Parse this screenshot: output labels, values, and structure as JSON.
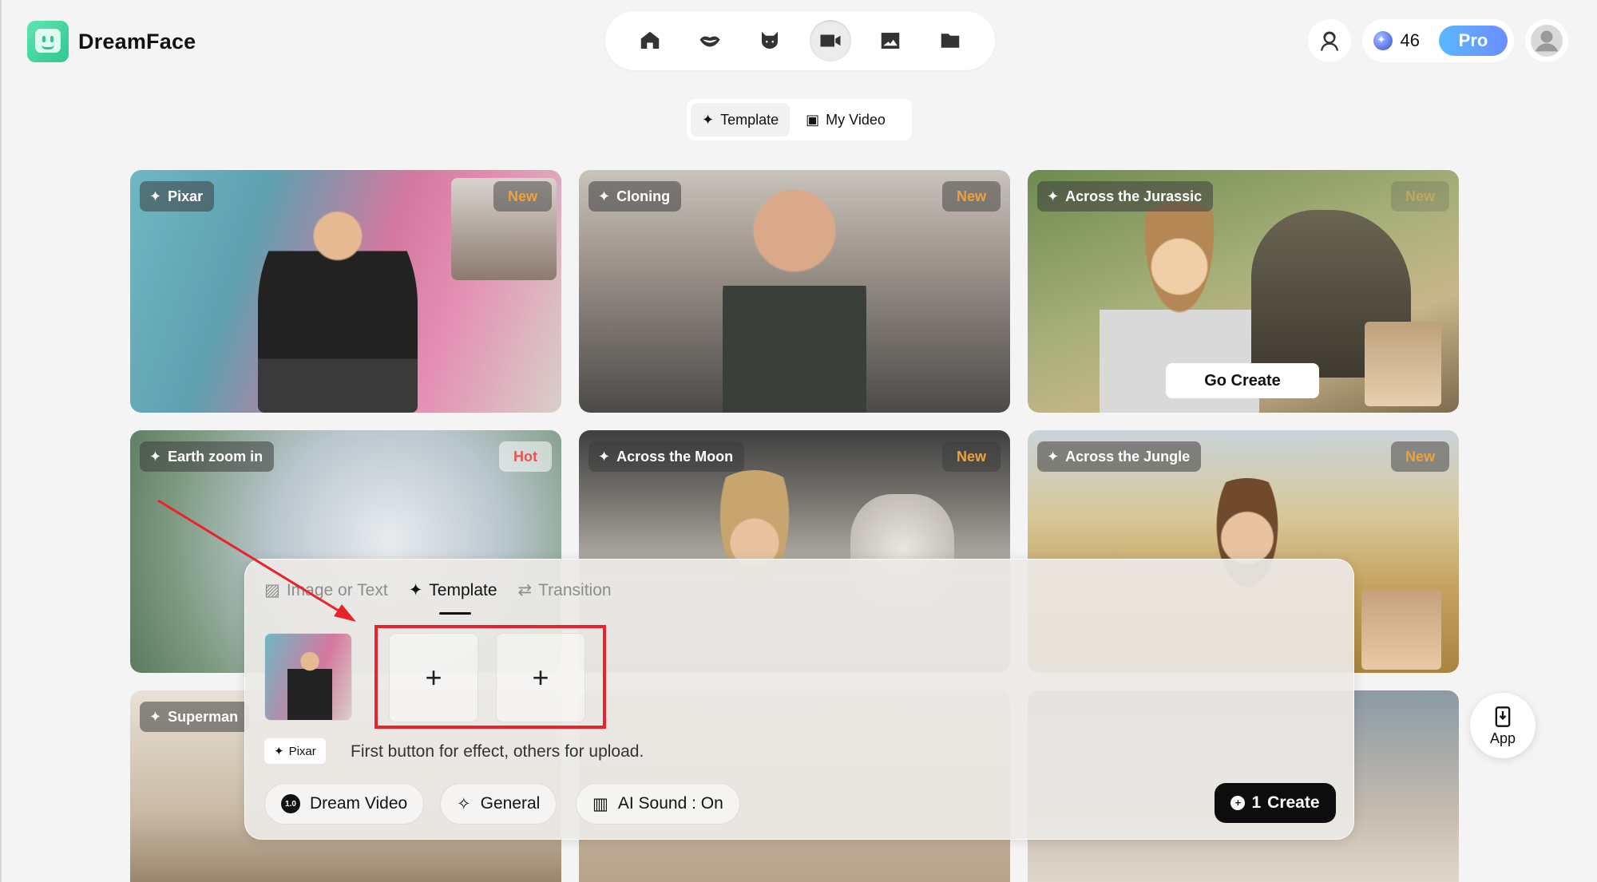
{
  "app": {
    "name": "DreamFace"
  },
  "nav": {
    "items": [
      {
        "icon": "home-icon"
      },
      {
        "icon": "lips-icon"
      },
      {
        "icon": "cat-icon"
      },
      {
        "icon": "video-camera-icon",
        "active": true
      },
      {
        "icon": "image-icon"
      },
      {
        "icon": "folder-icon"
      }
    ]
  },
  "header": {
    "credits": "46",
    "pro_label": "Pro"
  },
  "segment": {
    "template_label": "Template",
    "myvideo_label": "My Video"
  },
  "cards": [
    {
      "title": "Pixar",
      "badge": "New"
    },
    {
      "title": "Cloning",
      "badge": "New"
    },
    {
      "title": "Across the Jurassic",
      "badge": "New",
      "action": "Go Create"
    },
    {
      "title": "Earth zoom in",
      "badge": "Hot"
    },
    {
      "title": "Across the Moon",
      "badge": "New"
    },
    {
      "title": "Across the Jungle",
      "badge": "New"
    },
    {
      "title": "Superman"
    }
  ],
  "panel": {
    "tabs": [
      "Image or Text",
      "Template",
      "Transition"
    ],
    "active_tab": "Template",
    "plus": "+",
    "selected_template": "Pixar",
    "hint": "First button for effect, others for upload.",
    "model": {
      "version": "1.0",
      "label": "Dream Video"
    },
    "style": "General",
    "sound": "AI Sound : On",
    "create": {
      "cost": "1",
      "label": "Create"
    }
  },
  "app_button": "App",
  "colors": {
    "accent_green": "#2fc58f",
    "highlight_red": "#e8242a",
    "badge_new": "#f0a23a",
    "badge_hot": "#ee5151"
  }
}
